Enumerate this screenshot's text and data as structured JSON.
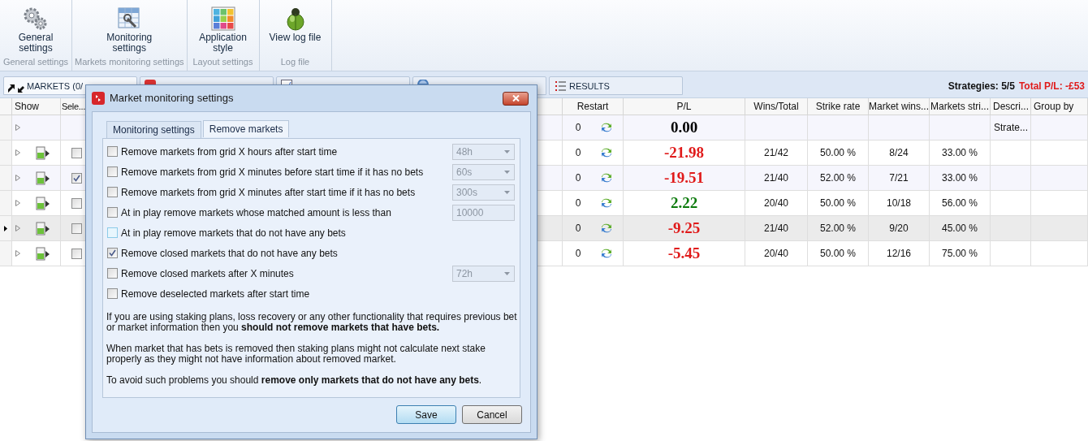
{
  "toolbar": {
    "groups": [
      {
        "buttons": [
          {
            "label": "General settings"
          }
        ],
        "caption": "General settings"
      },
      {
        "buttons": [
          {
            "label": "Monitoring settings"
          }
        ],
        "caption": "Markets monitoring settings"
      },
      {
        "buttons": [
          {
            "label": "Application style"
          }
        ],
        "caption": "Layout settings"
      },
      {
        "buttons": [
          {
            "label": "View log file"
          }
        ],
        "caption": "Log file"
      }
    ]
  },
  "tabs": [
    {
      "label": "MARKETS (0/",
      "selected": true
    },
    {
      "selected": false
    },
    {
      "selected": false
    },
    {
      "selected": false
    },
    {
      "label": "RESULTS",
      "selected": false
    }
  ],
  "summary": {
    "strategies": "Strategies: 5/5",
    "total_pl": "Total P/L: -£53"
  },
  "grid": {
    "columns": [
      "Show",
      "Sele...",
      "",
      "Restart",
      "P/L",
      "Wins/Total",
      "Strike rate",
      "Market wins...",
      "Markets stri...",
      "Descri...",
      "Group by"
    ],
    "rows": [
      {
        "kind": "group",
        "current": false,
        "restart": "0",
        "pl": "0.00",
        "color": "#000000",
        "description": "Strate..."
      },
      {
        "kind": "strategy",
        "current": false,
        "checked": false,
        "restart": "0",
        "pl": "-21.98",
        "color": "#e01b1b",
        "wins_total": "21/42",
        "strike_rate": "50.00 %",
        "market_wins": "8/24",
        "markets_strike": "33.00 %"
      },
      {
        "kind": "strategy",
        "current": false,
        "checked": true,
        "restart": "0",
        "pl": "-19.51",
        "color": "#e01b1b",
        "wins_total": "21/40",
        "strike_rate": "52.00 %",
        "market_wins": "7/21",
        "markets_strike": "33.00 %"
      },
      {
        "kind": "strategy",
        "current": false,
        "checked": false,
        "restart": "0",
        "pl": "2.22",
        "color": "#0c7a0c",
        "wins_total": "20/40",
        "strike_rate": "50.00 %",
        "market_wins": "10/18",
        "markets_strike": "56.00 %"
      },
      {
        "kind": "strategy",
        "current": true,
        "checked": false,
        "restart": "0",
        "pl": "-9.25",
        "color": "#e01b1b",
        "wins_total": "21/40",
        "strike_rate": "52.00 %",
        "market_wins": "9/20",
        "markets_strike": "45.00 %"
      },
      {
        "kind": "strategy",
        "current": false,
        "checked": false,
        "restart": "0",
        "pl": "-5.45",
        "color": "#e01b1b",
        "wins_total": "20/40",
        "strike_rate": "50.00 %",
        "market_wins": "12/16",
        "markets_strike": "75.00 %"
      }
    ]
  },
  "dialog": {
    "title": "Market monitoring settings",
    "tabs": [
      {
        "label": "Monitoring settings",
        "selected": false
      },
      {
        "label": "Remove markets",
        "selected": true
      }
    ],
    "options": [
      {
        "label": "Remove markets from grid X hours after start time",
        "checked": false,
        "hovered": false,
        "control": {
          "kind": "select",
          "value": "48h"
        }
      },
      {
        "label": "Remove markets from grid X minutes before start time if it has no bets",
        "checked": false,
        "hovered": false,
        "control": {
          "kind": "select",
          "value": "60s"
        }
      },
      {
        "label": "Remove markets from grid X minutes after start time if it has no bets",
        "checked": false,
        "hovered": false,
        "control": {
          "kind": "select",
          "value": "300s"
        }
      },
      {
        "label": "At in play remove markets whose matched amount is less than",
        "checked": false,
        "hovered": false,
        "control": {
          "kind": "input",
          "value": "10000"
        }
      },
      {
        "label": "At in play remove markets that do not have any bets",
        "checked": false,
        "hovered": true
      },
      {
        "label": "Remove closed markets that do not have any bets",
        "checked": true,
        "hovered": false
      },
      {
        "label": "Remove closed markets after X minutes",
        "checked": false,
        "hovered": false,
        "control": {
          "kind": "select",
          "value": "72h"
        }
      },
      {
        "label": "Remove deselected markets after start time",
        "checked": false,
        "hovered": false
      }
    ],
    "notes": [
      "If you are using staking plans, loss recovery or any other functionality that requires previous bet or market information then you **should not remove markets that have bets.**",
      "When market that has bets is removed then staking plans might not calculate next stake properly as they might not have information about removed market.",
      "To avoid such problems you should **remove only markets that do not have any bets**."
    ],
    "buttons": [
      {
        "label": "Save",
        "default": true
      },
      {
        "label": "Cancel",
        "default": false
      }
    ]
  }
}
